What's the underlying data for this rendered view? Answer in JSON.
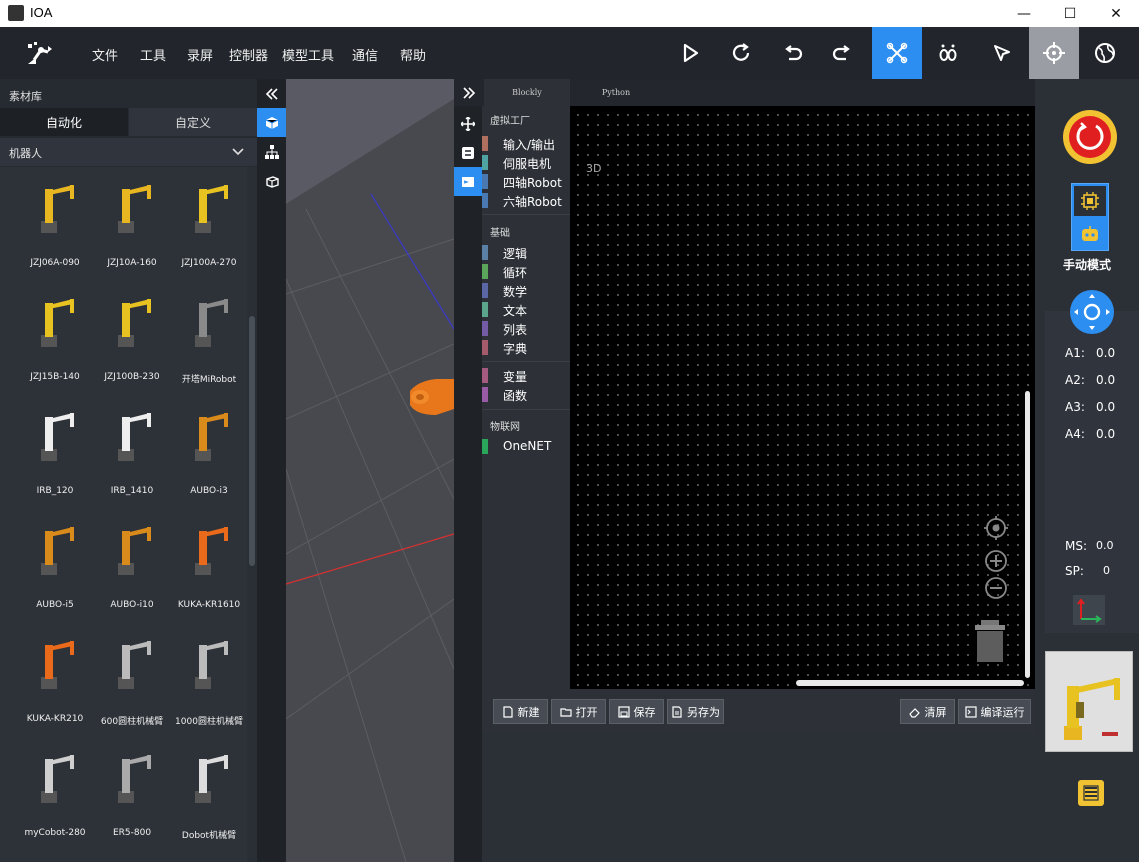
{
  "window": {
    "title": "IOA",
    "minimize": "—",
    "maximize": "☐",
    "close": "✕"
  },
  "menu": [
    "文件",
    "工具",
    "录屏",
    "控制器",
    "模型工具",
    "通信",
    "帮助"
  ],
  "toolbar": {
    "icons": [
      "run-icon",
      "refresh-icon",
      "undo-icon",
      "redo-icon",
      "drone-icon",
      "footprint-icon",
      "pointer-icon",
      "crosshair-icon",
      "globe-icon"
    ],
    "active_color": "#2b8ef0"
  },
  "library": {
    "title": "素材库",
    "tabs": [
      "自动化",
      "自定义"
    ],
    "section": "机器人",
    "robots": [
      {
        "name": "JZJ06A-090",
        "color": "#e8b620"
      },
      {
        "name": "JZJ10A-160",
        "color": "#e8b620"
      },
      {
        "name": "JZJ100A-270",
        "color": "#e8c220"
      },
      {
        "name": "JZJ15B-140",
        "color": "#e8c220"
      },
      {
        "name": "JZJ100B-230",
        "color": "#e8c220"
      },
      {
        "name": "开塔MiRobot",
        "color": "#8a8a8a"
      },
      {
        "name": "IRB_120",
        "color": "#eeeeee"
      },
      {
        "name": "IRB_1410",
        "color": "#eeeeee"
      },
      {
        "name": "AUBO-i3",
        "color": "#d88a1a"
      },
      {
        "name": "AUBO-i5",
        "color": "#d88a1a"
      },
      {
        "name": "AUBO-i10",
        "color": "#d88a1a"
      },
      {
        "name": "KUKA-KR1610",
        "color": "#e86a1a"
      },
      {
        "name": "KUKA-KR210",
        "color": "#e86a1a"
      },
      {
        "name": "600圆柱机械臂",
        "color": "#bbbbbb"
      },
      {
        "name": "1000圆柱机械臂",
        "color": "#bbbbbb"
      },
      {
        "name": "myCobot-280",
        "color": "#cfcfcf"
      },
      {
        "name": "ER5-800",
        "color": "#aaaaaa"
      },
      {
        "name": "Dobot机械臂",
        "color": "#dddddd"
      }
    ]
  },
  "viewport": {
    "label": "3D"
  },
  "blockly": {
    "tabs": [
      "Blockly",
      "Python"
    ],
    "groups": [
      {
        "head": "虚拟工厂",
        "items": [
          {
            "label": "输入/输出",
            "color": "#b07060"
          },
          {
            "label": "伺服电机",
            "color": "#4fa3a0"
          },
          {
            "label": "四轴Robot",
            "color": "#4a78b0"
          },
          {
            "label": "六轴Robot",
            "color": "#4a78b0"
          }
        ]
      },
      {
        "head": "基础",
        "items": [
          {
            "label": "逻辑",
            "color": "#5b80a5"
          },
          {
            "label": "循环",
            "color": "#5ba55b"
          },
          {
            "label": "数学",
            "color": "#5b67a5"
          },
          {
            "label": "文本",
            "color": "#5ba58c"
          },
          {
            "label": "列表",
            "color": "#745ba5"
          },
          {
            "label": "字典",
            "color": "#a55b6b"
          }
        ]
      },
      {
        "head": "",
        "items": [
          {
            "label": "变量",
            "color": "#a55b80"
          },
          {
            "label": "函数",
            "color": "#995ba5"
          }
        ]
      },
      {
        "head": "物联网",
        "items": [
          {
            "label": "OneNET",
            "color": "#2aa65a"
          }
        ]
      }
    ],
    "buttons": {
      "new": "新建",
      "open": "打开",
      "save": "保存",
      "save_as": "另存为",
      "clear": "清屏",
      "compile_run": "编译运行"
    }
  },
  "control": {
    "mode": "手动模式",
    "axes": [
      {
        "label": "A1:",
        "value": "0.0"
      },
      {
        "label": "A2:",
        "value": "0.0"
      },
      {
        "label": "A3:",
        "value": "0.0"
      },
      {
        "label": "A4:",
        "value": "0.0"
      }
    ],
    "ms": {
      "label": "MS:",
      "value": "0.0"
    },
    "sp": {
      "label": "SP:",
      "value": "0"
    }
  }
}
